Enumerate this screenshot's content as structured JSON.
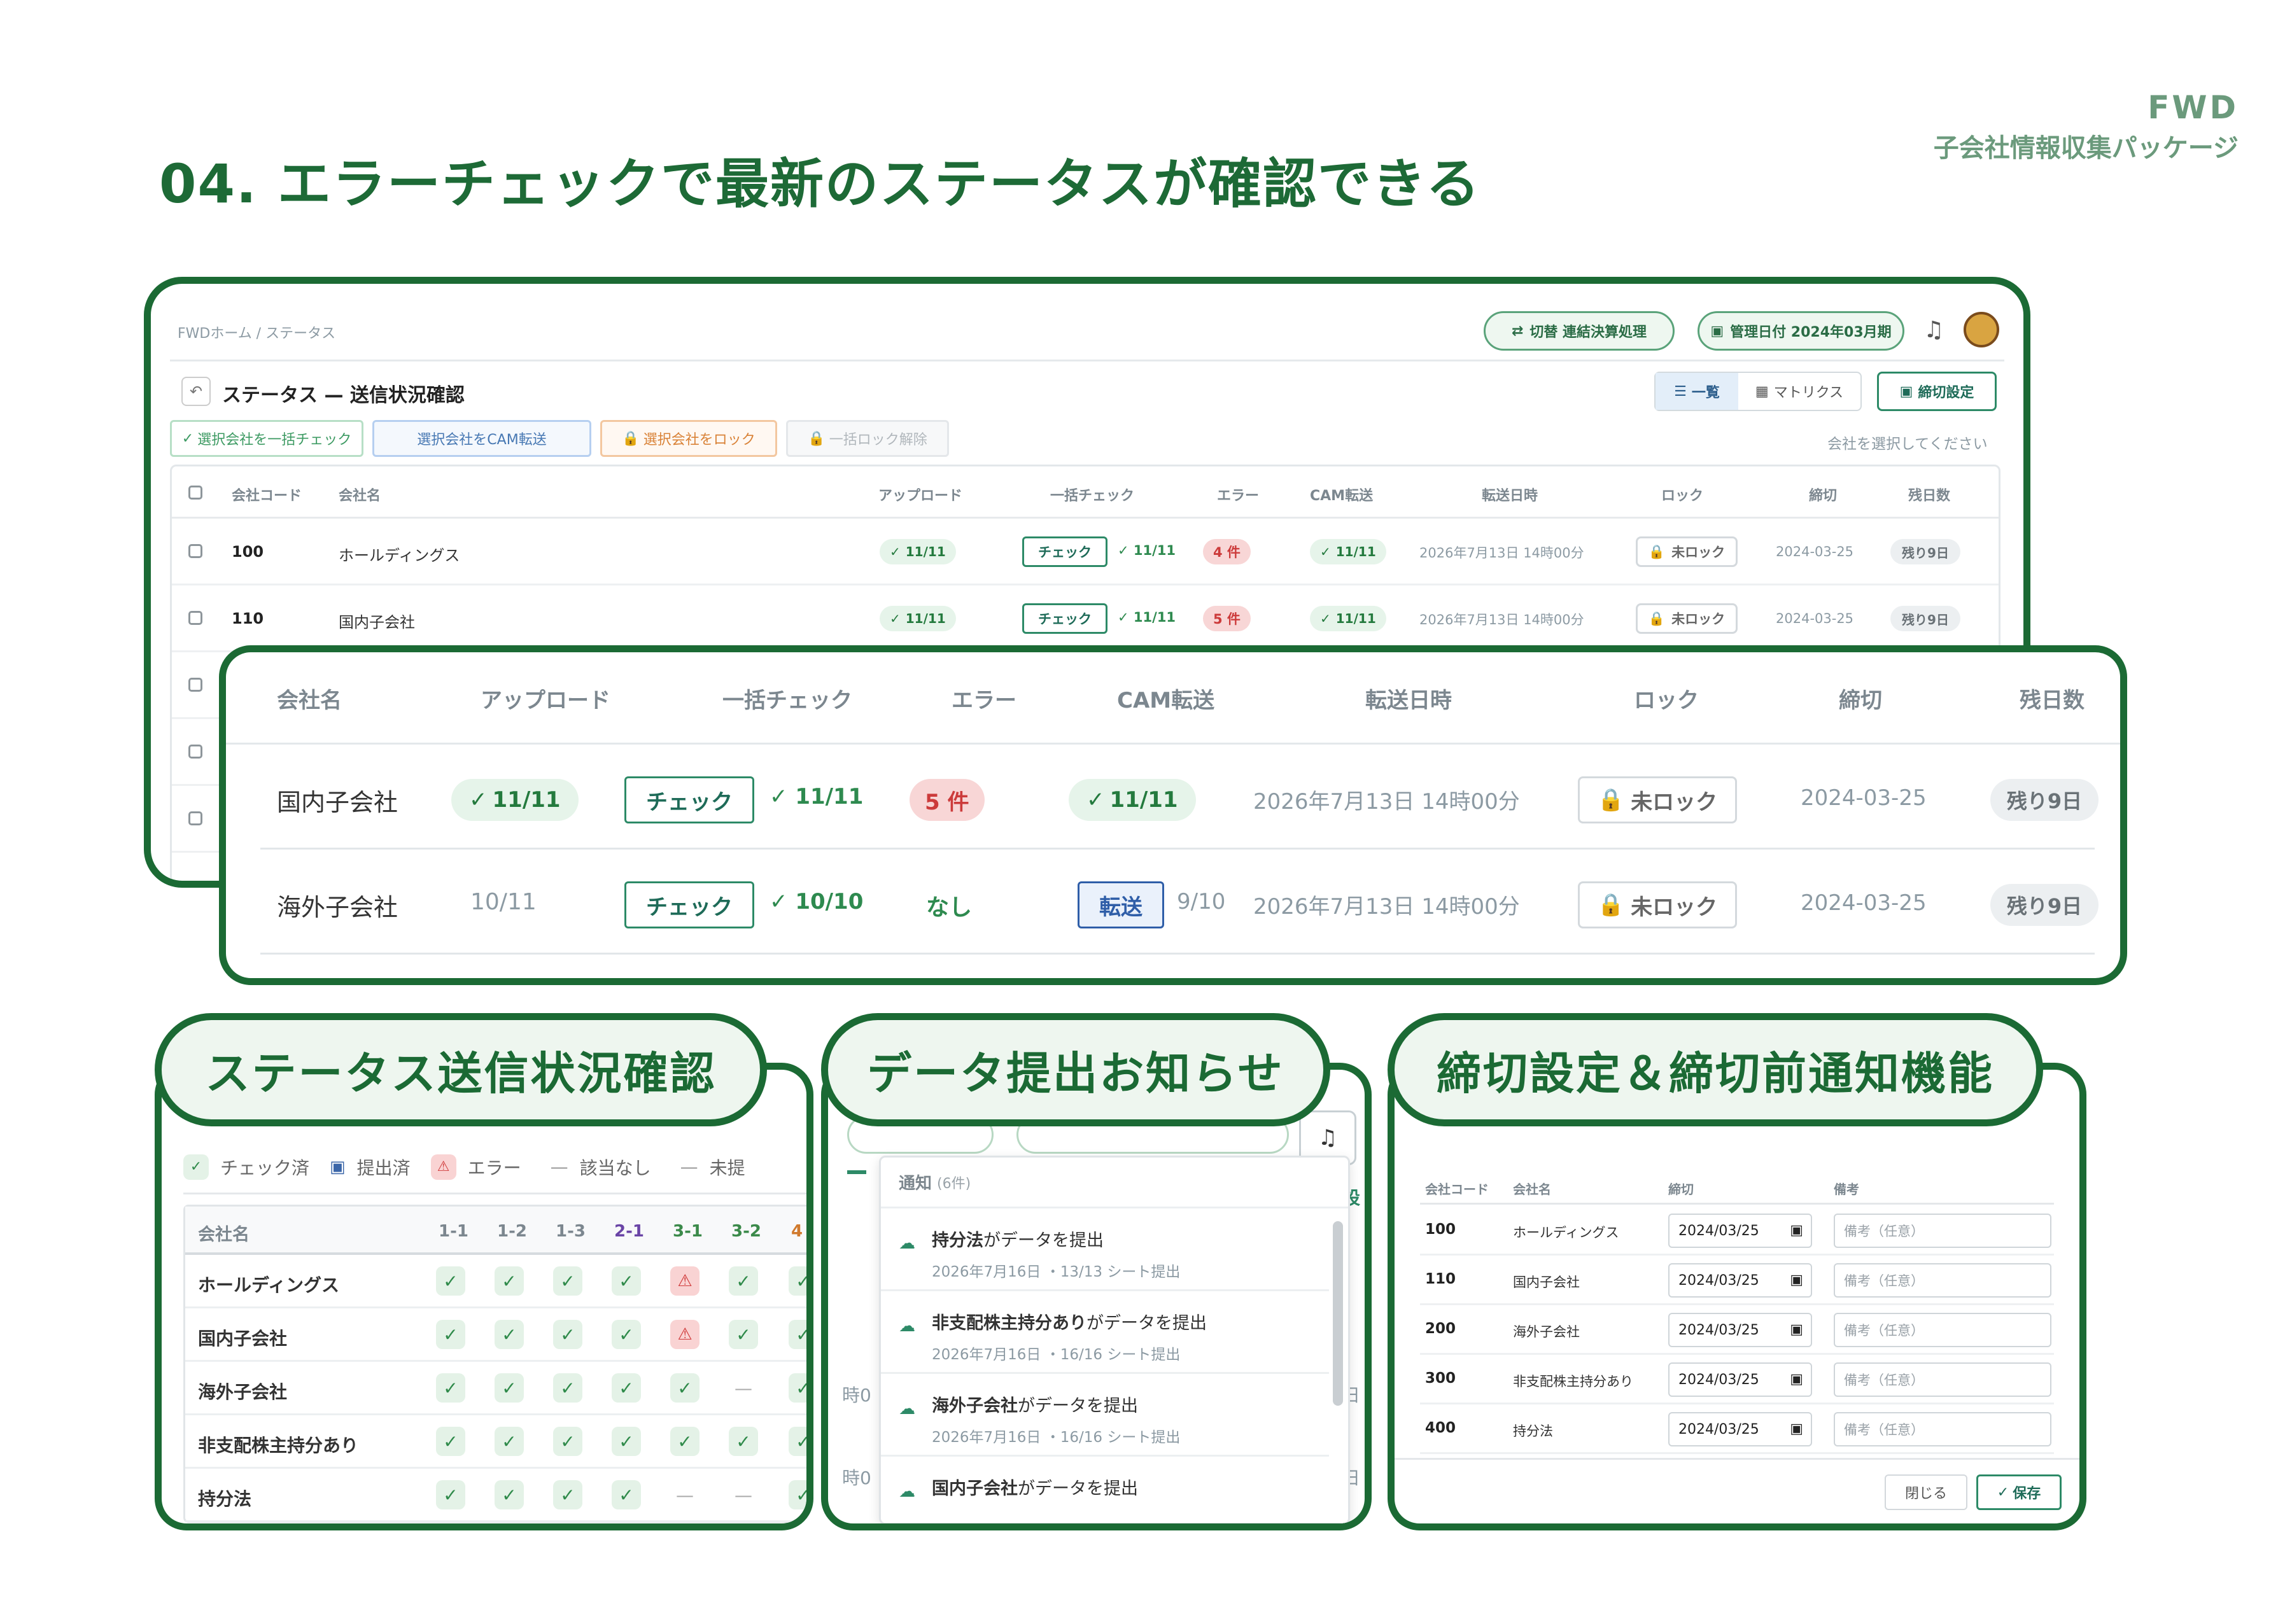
{
  "heading": "04. エラーチェックで最新のステータスが確認できる",
  "brand": {
    "name": "FWD",
    "sub": "子会社情報収集パッケージ"
  },
  "screen": {
    "breadcrumb": "FWDホーム / ステータス",
    "header_switch": "切替 連結決算処理",
    "header_date": "管理日付 2024年03月期",
    "page_title": "ステータス — 送信状況確認",
    "view_list": "一覧",
    "view_matrix": "マトリクス",
    "deadline_button": "締切設定",
    "actions": [
      "選択会社を一括チェック",
      "選択会社をCAM転送",
      "選択会社をロック",
      "一括ロック解除"
    ],
    "select_hint": "会社を選択してください",
    "columns": [
      "会社コード",
      "会社名",
      "アップロード",
      "一括チェック",
      "エラー",
      "CAM転送",
      "転送日時",
      "ロック",
      "締切",
      "残日数"
    ],
    "rows": [
      {
        "code": "100",
        "name": "ホールディングス",
        "upload": "11/11",
        "check_btn": "チェック",
        "check": "11/11",
        "error": "4 件",
        "cam": "11/11",
        "datetime": "2026年7月13日 14時00分",
        "lock": "未ロック",
        "deadline": "2024-03-25",
        "remaining": "残り9日"
      },
      {
        "code": "110",
        "name": "国内子会社",
        "upload": "11/11",
        "check_btn": "チェック",
        "check": "11/11",
        "error": "5 件",
        "cam": "11/11",
        "datetime": "2026年7月13日 14時00分",
        "lock": "未ロック",
        "deadline": "2024-03-25",
        "remaining": "残り9日"
      }
    ]
  },
  "zoom": {
    "columns": [
      "会社名",
      "アップロード",
      "一括チェック",
      "エラー",
      "CAM転送",
      "転送日時",
      "ロック",
      "締切",
      "残日数"
    ],
    "rows": [
      {
        "name": "国内子会社",
        "upload": "11/11",
        "check_btn": "チェック",
        "check": "11/11",
        "error": "5 件",
        "cam": "11/11",
        "datetime": "2026年7月13日 14時00分",
        "lock": "未ロック",
        "deadline": "2024-03-25",
        "remaining": "残り9日"
      },
      {
        "name": "海外子会社",
        "upload": "10/11",
        "check_btn": "チェック",
        "check": "10/10",
        "error": "なし",
        "cam_btn": "転送",
        "cam": "9/10",
        "datetime": "2026年7月13日 14時00分",
        "lock": "未ロック",
        "deadline": "2024-03-25",
        "remaining": "残り9日"
      }
    ]
  },
  "panel1": {
    "label": "ステータス送信状況確認",
    "legend": [
      "チェック済",
      "提出済",
      "エラー",
      "該当なし",
      "未提"
    ],
    "columns": [
      "会社名",
      "1-1",
      "1-2",
      "1-3",
      "2-1",
      "3-1",
      "3-2",
      "4"
    ],
    "rows": [
      {
        "name": "ホールディングス",
        "cells": [
          "c",
          "c",
          "c",
          "c",
          "w",
          "c",
          "c"
        ]
      },
      {
        "name": "国内子会社",
        "cells": [
          "c",
          "c",
          "c",
          "c",
          "w",
          "c",
          "c"
        ]
      },
      {
        "name": "海外子会社",
        "cells": [
          "c",
          "c",
          "c",
          "c",
          "c",
          "d",
          "c"
        ]
      },
      {
        "name": "非支配株主持分あり",
        "cells": [
          "c",
          "c",
          "c",
          "c",
          "c",
          "c",
          "c"
        ]
      },
      {
        "name": "持分法",
        "cells": [
          "c",
          "c",
          "c",
          "c",
          "d",
          "d",
          "c"
        ]
      }
    ]
  },
  "panel2": {
    "label": "データ提出お知らせ",
    "notice_title": "通知",
    "notice_count": "(6件)",
    "items": [
      {
        "who": "持分法",
        "msg": "がデータを提出",
        "date": "2026年7月16日",
        "sheets": "・13/13 シート提出"
      },
      {
        "who": "非支配株主持分あり",
        "msg": "がデータを提出",
        "date": "2026年7月16日",
        "sheets": "・16/16 シート提出"
      },
      {
        "who": "海外子会社",
        "msg": "がデータを提出",
        "date": "2026年7月16日",
        "sheets": "・16/16 シート提出"
      },
      {
        "who": "国内子会社",
        "msg": "がデータを提出",
        "date": "",
        "sheets": ""
      }
    ],
    "side_marks": [
      "時0",
      "時0"
    ],
    "right_marks": [
      "設",
      "日",
      "日"
    ]
  },
  "panel3": {
    "label": "締切設定＆締切前通知機能",
    "columns": [
      "会社コード",
      "会社名",
      "締切",
      "備考"
    ],
    "rows": [
      {
        "code": "100",
        "name": "ホールディングス",
        "date": "2024/03/25",
        "note": "備考（任意）"
      },
      {
        "code": "110",
        "name": "国内子会社",
        "date": "2024/03/25",
        "note": "備考（任意）"
      },
      {
        "code": "200",
        "name": "海外子会社",
        "date": "2024/03/25",
        "note": "備考（任意）"
      },
      {
        "code": "300",
        "name": "非支配株主持分あり",
        "date": "2024/03/25",
        "note": "備考（任意）"
      },
      {
        "code": "400",
        "name": "持分法",
        "date": "2024/03/25",
        "note": "備考（任意）"
      }
    ],
    "close": "閉じる",
    "save": "保存"
  }
}
